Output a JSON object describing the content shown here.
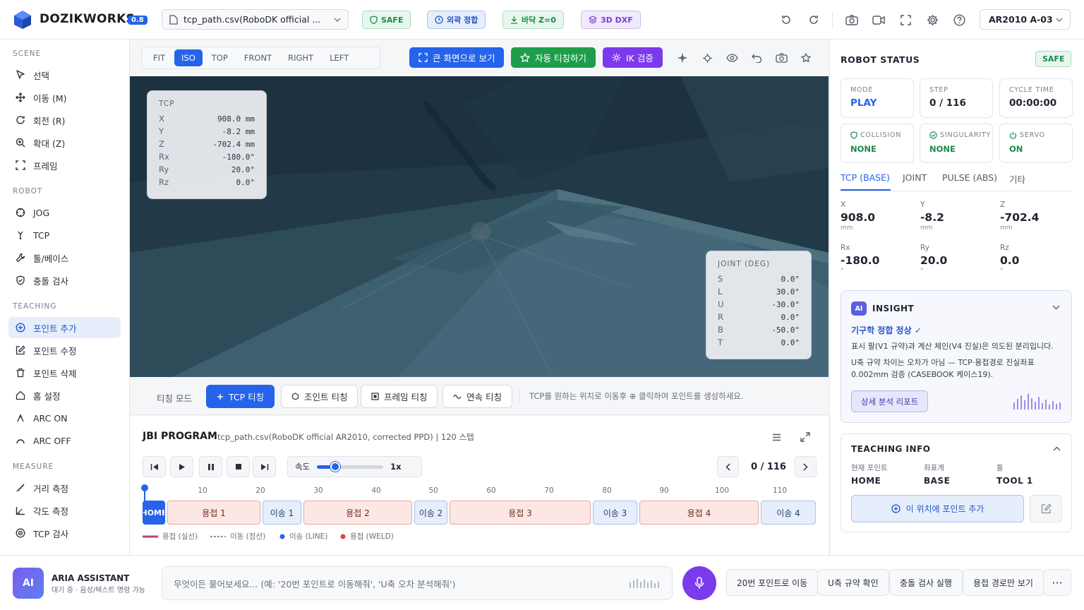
{
  "app": {
    "brand": "DOZIKWORKS",
    "version": "0.8"
  },
  "header": {
    "file_name": "tcp_path.csv(RoboDK official ...",
    "pills": {
      "safe": "SAFE",
      "external": "외곽 정합",
      "floor": "바닥 Z=0",
      "dxf": "3D DXF"
    },
    "robot": "AR2010 A-03"
  },
  "sidebar": {
    "sections": [
      "SCENE",
      "ROBOT",
      "TEACHING",
      "MEASURE"
    ],
    "scene": [
      {
        "label": "선택",
        "icon": "cursor-icon"
      },
      {
        "label": "이동 (M)",
        "icon": "move-icon"
      },
      {
        "label": "회전 (R)",
        "icon": "rotate-icon"
      },
      {
        "label": "확대 (Z)",
        "icon": "zoom-icon"
      },
      {
        "label": "프레임",
        "icon": "frame-icon"
      }
    ],
    "robot": [
      {
        "label": "JOG",
        "icon": "jog-icon"
      },
      {
        "label": "TCP",
        "icon": "tcp-icon"
      },
      {
        "label": "툴/베이스",
        "icon": "wrench-icon"
      },
      {
        "label": "충돌 검사",
        "icon": "shield-icon"
      }
    ],
    "teaching": [
      {
        "label": "포인트 추가",
        "icon": "plus-circle-icon"
      },
      {
        "label": "포인트 수정",
        "icon": "edit-icon"
      },
      {
        "label": "포인트 삭제",
        "icon": "trash-icon"
      },
      {
        "label": "홈 설정",
        "icon": "home-icon"
      },
      {
        "label": "ARC ON",
        "icon": "arc-on-icon"
      },
      {
        "label": "ARC OFF",
        "icon": "arc-off-icon"
      }
    ],
    "measure": [
      {
        "label": "거리 측정",
        "icon": "ruler-icon"
      },
      {
        "label": "각도 측정",
        "icon": "angle-icon"
      },
      {
        "label": "TCP 검사",
        "icon": "target-icon"
      }
    ]
  },
  "viewtools": {
    "views": [
      "FIT",
      "ISO",
      "TOP",
      "FRONT",
      "RIGHT",
      "LEFT"
    ],
    "active_view": "ISO",
    "fullscreen": "큰 화면으로 보기",
    "auto_teach": "자동 티칭하기",
    "ik_check": "IK 검증"
  },
  "tcp_panel": {
    "title": "TCP",
    "rows": [
      {
        "k": "X",
        "v": "908.0 mm"
      },
      {
        "k": "Y",
        "v": "-8.2 mm"
      },
      {
        "k": "Z",
        "v": "-702.4 mm"
      },
      {
        "k": "Rx",
        "v": "-180.0°"
      },
      {
        "k": "Ry",
        "v": "20.0°"
      },
      {
        "k": "Rz",
        "v": "0.0°"
      }
    ]
  },
  "joint_panel": {
    "title": "JOINT (DEG)",
    "rows": [
      {
        "k": "S",
        "v": "0.0°"
      },
      {
        "k": "L",
        "v": "30.0°"
      },
      {
        "k": "U",
        "v": "-30.0°"
      },
      {
        "k": "R",
        "v": "0.0°"
      },
      {
        "k": "B",
        "v": "-50.0°"
      },
      {
        "k": "T",
        "v": "0.0°"
      }
    ]
  },
  "teaching": {
    "mode_label": "티칭 모드",
    "buttons": [
      "TCP 티칭",
      "조인트 티칭",
      "프레임 티칭",
      "연속 티칭"
    ],
    "hint": "TCP를 원하는 위치로 이동후 ⊕ 클릭하여 포인트를 생성하세요."
  },
  "jbi": {
    "title": "JBI PROGRAM",
    "subtitle": "tcp_path.csv(RoboDK official AR2010, corrected PPD) | 120 스텝",
    "speed_label": "속도",
    "speed_value": "1x",
    "speed_fraction": 0.27,
    "step": "0 / 116",
    "ticks": [
      "10",
      "20",
      "30",
      "40",
      "50",
      "60",
      "70",
      "80",
      "90",
      "100",
      "110"
    ],
    "segments": [
      {
        "label": "HOME",
        "kind": "home"
      },
      {
        "label": "용접 1",
        "kind": "weld"
      },
      {
        "label": "이송 1",
        "kind": "move"
      },
      {
        "label": "용접 2",
        "kind": "weld"
      },
      {
        "label": "이송 2",
        "kind": "move"
      },
      {
        "label": "용접 3",
        "kind": "weld"
      },
      {
        "label": "이송 3",
        "kind": "move"
      },
      {
        "label": "용접 4",
        "kind": "weld"
      },
      {
        "label": "이송 4",
        "kind": "move"
      }
    ],
    "legend": [
      "용접 (실선)",
      "이동 (점선)",
      "이송 (LINE)",
      "용접 (WELD)"
    ]
  },
  "robot_status": {
    "title": "ROBOT STATUS",
    "badge": "SAFE",
    "stats": [
      {
        "label": "MODE",
        "value": "PLAY",
        "color": "#2563eb"
      },
      {
        "label": "STEP",
        "value": "0 / 116",
        "color": "#1f2430"
      },
      {
        "label": "CYCLE TIME",
        "value": "00:00:00",
        "color": "#1f2430"
      },
      {
        "label": "COLLISION",
        "value": "NONE",
        "color": "#1a8a4a"
      },
      {
        "label": "SINGULARITY",
        "value": "NONE",
        "color": "#1a8a4a"
      },
      {
        "label": "SERVO",
        "value": "ON",
        "color": "#1a8a4a"
      }
    ],
    "tabs": [
      "TCP (BASE)",
      "JOINT",
      "PULSE (ABS)",
      "기타"
    ],
    "coords": [
      {
        "label": "X",
        "value": "908.0",
        "unit": "mm"
      },
      {
        "label": "Y",
        "value": "-8.2",
        "unit": "mm"
      },
      {
        "label": "Z",
        "value": "-702.4",
        "unit": "mm"
      },
      {
        "label": "Rx",
        "value": "-180.0",
        "unit": "°"
      },
      {
        "label": "Ry",
        "value": "20.0",
        "unit": "°"
      },
      {
        "label": "Rz",
        "value": "0.0",
        "unit": "°"
      }
    ]
  },
  "insight": {
    "badge": "AI",
    "title": "INSIGHT",
    "headline": "기구학 정합 정상 ✓",
    "line1": "표시 팔(V1 규약)과 계산 체인(V4 진실)은 의도된 분리입니다.",
    "line2": "U축 규약 차이는 오차가 아님 — TCP·용접경로 진실좌표 0.002mm 검증 (CASEBOOK 케이스19).",
    "button": "상세 분석 리포트"
  },
  "teaching_info": {
    "title": "TEACHING INFO",
    "fields": [
      {
        "label": "현재 포인트",
        "value": "HOME"
      },
      {
        "label": "좌표계",
        "value": "BASE"
      },
      {
        "label": "툴",
        "value": "TOOL 1"
      }
    ],
    "add_button": "이 위치에 포인트 추가"
  },
  "assistant": {
    "avatar": "AI",
    "name": "ARIA ASSISTANT",
    "status": "대기 중 · 음성/텍스트 명령 가능",
    "placeholder": "무엇이든 물어보세요... (예: '20번 포인트로 이동해줘', 'U축 오차 분석해줘')",
    "chips": [
      "20번 포인트로 이동",
      "U축 규약 확인",
      "충돌 검사 실행",
      "용접 경로만 보기"
    ],
    "more": "···"
  },
  "colors": {
    "accent": "#2563eb",
    "safe": "#1a8a4a",
    "weld": "#fde7e4",
    "move": "#e6eefc",
    "viewport": "#2b4452"
  }
}
